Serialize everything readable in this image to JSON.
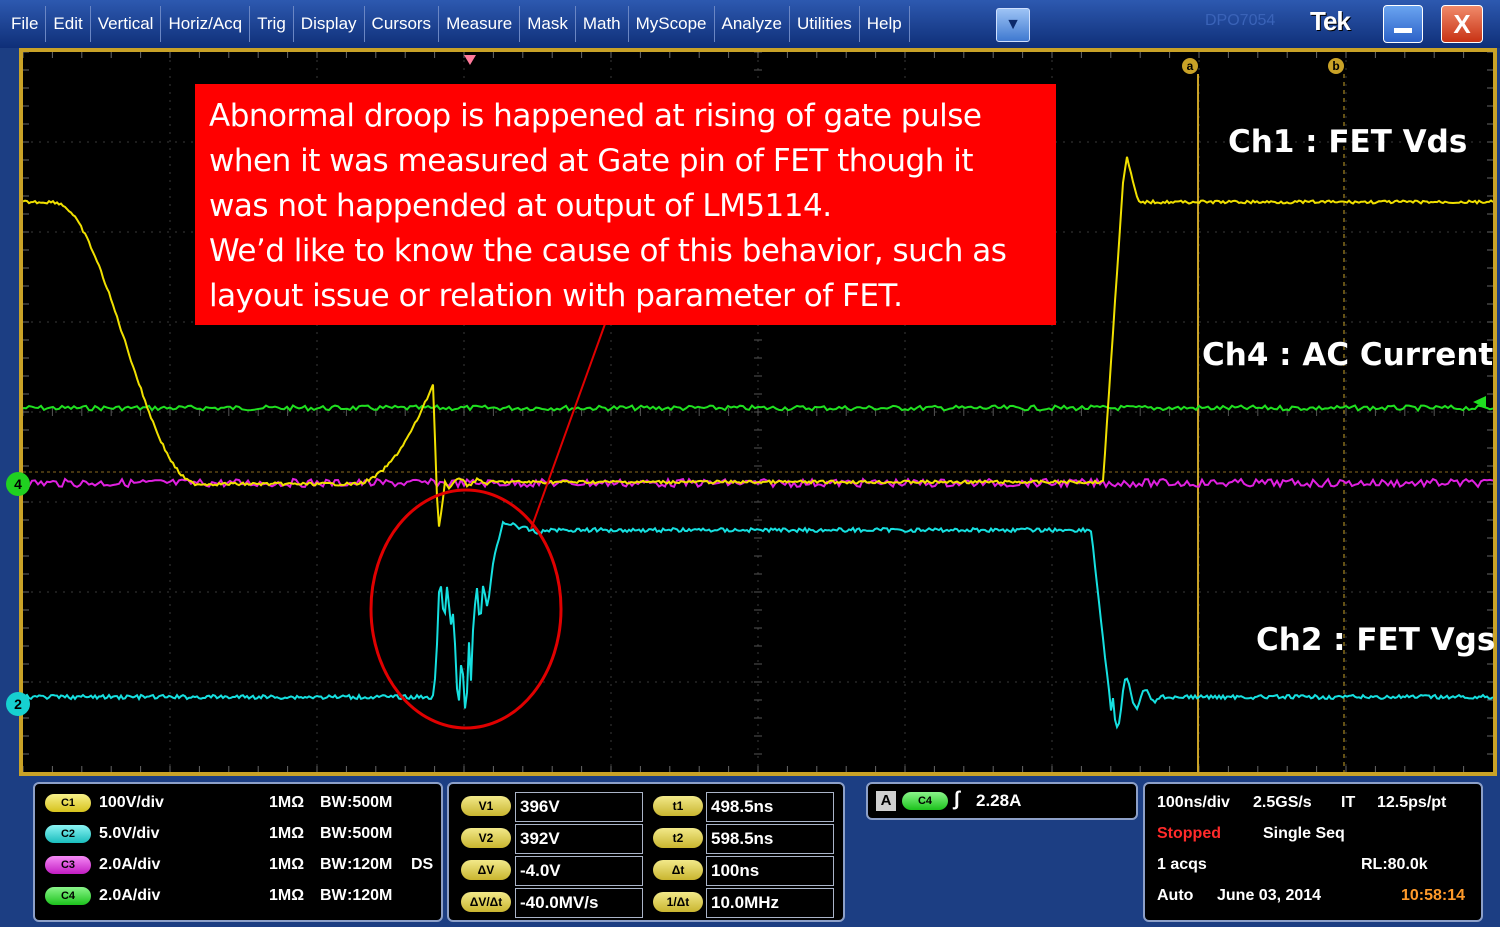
{
  "menu": [
    "File",
    "Edit",
    "Vertical",
    "Horiz/Acq",
    "Trig",
    "Display",
    "Cursors",
    "Measure",
    "Mask",
    "Math",
    "MyScope",
    "Analyze",
    "Utilities",
    "Help"
  ],
  "window": {
    "model": "DPO7054",
    "logo": "Tek",
    "close_glyph": "X",
    "dropdown_glyph": "▼"
  },
  "annotation": {
    "text": "Abnormal droop is happened at rising of gate pulse\nwhen it was measured at Gate pin of FET though it\nwas not happended at output of LM5114.\nWe’d like to know the cause of this behavior, such as\nlayout issue or relation with parameter of FET."
  },
  "channel_labels": {
    "ch1": "Ch1 : FET Vds",
    "ch4": "Ch4 : AC Current",
    "ch2": "Ch2 : FET Vgs"
  },
  "markers": {
    "cursor_a": "a",
    "cursor_b": "b",
    "ch4_ref": "4",
    "ch2_ref": "2"
  },
  "colors": {
    "ch1": "#f0e000",
    "ch2": "#16e0e0",
    "ch3": "#e020e0",
    "ch4": "#20e020",
    "annotation_bg": "#ff0000",
    "circle": "#e00000",
    "cursor": "#c9a227"
  },
  "vertical": {
    "channels": [
      {
        "badge": "C1",
        "scale": "100V/div",
        "impedance": "1MΩ",
        "bw_label": "BW",
        "bw": ":500M",
        "extra": ""
      },
      {
        "badge": "C2",
        "scale": "5.0V/div",
        "impedance": "1MΩ",
        "bw_label": "BW",
        "bw": ":500M",
        "extra": ""
      },
      {
        "badge": "C3",
        "scale": "2.0A/div",
        "impedance": "1MΩ",
        "bw_label": "BW",
        "bw": ":120M",
        "extra": "DS"
      },
      {
        "badge": "C4",
        "scale": "2.0A/div",
        "impedance": "1MΩ",
        "bw_label": "BW",
        "bw": ":120M",
        "extra": ""
      }
    ]
  },
  "cursors": {
    "v1": {
      "label": "V1",
      "value": "396V"
    },
    "v2": {
      "label": "V2",
      "value": "392V"
    },
    "dv": {
      "label": "ΔV",
      "value": "-4.0V"
    },
    "dvdt": {
      "label": "ΔV/Δt",
      "value": "-40.0MV/s"
    },
    "t1": {
      "label": "t1",
      "value": "498.5ns"
    },
    "t2": {
      "label": "t2",
      "value": "598.5ns"
    },
    "dt": {
      "label": "Δt",
      "value": "100ns"
    },
    "inv_dt": {
      "label": "1/Δt",
      "value": "10.0MHz"
    }
  },
  "trigger": {
    "mode_badge": "A",
    "source": "C4",
    "slope": "∫",
    "level": "2.28A"
  },
  "acquisition": {
    "timebase": "100ns/div",
    "sample_rate": "2.5GS/s",
    "mode": "IT",
    "resolution": "12.5ps/pt",
    "state": "Stopped",
    "seq": "Single Seq",
    "acqs": "1 acqs",
    "record_length": "RL:80.0k",
    "trigger_mode": "Auto",
    "date": "June 03, 2014",
    "time": "10:58:14"
  }
}
